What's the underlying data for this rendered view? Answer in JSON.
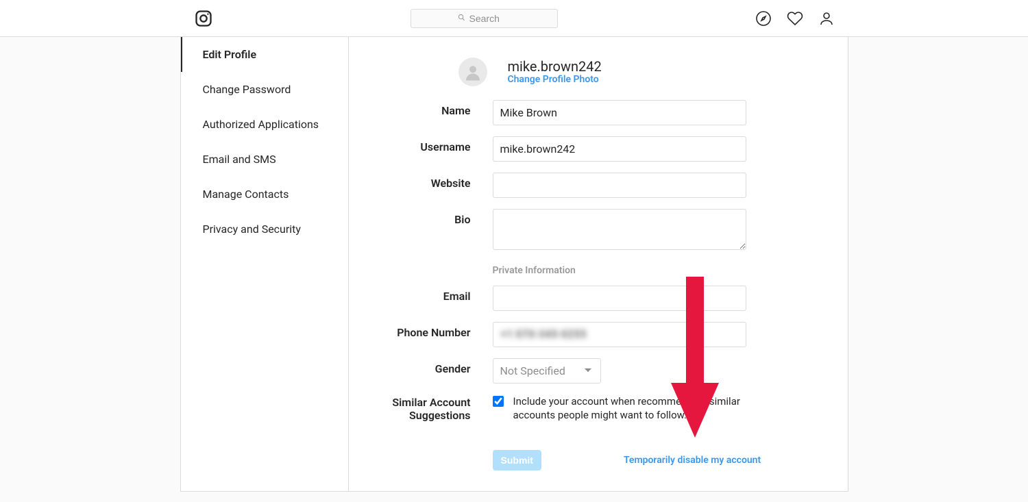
{
  "nav": {
    "search_placeholder": "Search"
  },
  "sidebar": {
    "items": [
      {
        "label": "Edit Profile",
        "active": true
      },
      {
        "label": "Change Password"
      },
      {
        "label": "Authorized Applications"
      },
      {
        "label": "Email and SMS"
      },
      {
        "label": "Manage Contacts"
      },
      {
        "label": "Privacy and Security"
      }
    ]
  },
  "profile": {
    "username_heading": "mike.brown242",
    "change_photo": "Change Profile Photo"
  },
  "form": {
    "name_label": "Name",
    "name_value": "Mike Brown",
    "username_label": "Username",
    "username_value": "mike.brown242",
    "website_label": "Website",
    "website_value": "",
    "bio_label": "Bio",
    "bio_value": "",
    "private_info_title": "Private Information",
    "email_label": "Email",
    "email_value": "",
    "phone_label": "Phone Number",
    "phone_value": "+1 070-345-0255",
    "gender_label": "Gender",
    "gender_value": "Not Specified",
    "similar_label": "Similar Account Suggestions",
    "similar_text": "Include your account when recommending similar accounts people might want to follow.",
    "similar_help": "[?]",
    "submit": "Submit",
    "disable_link": "Temporarily disable my account"
  }
}
